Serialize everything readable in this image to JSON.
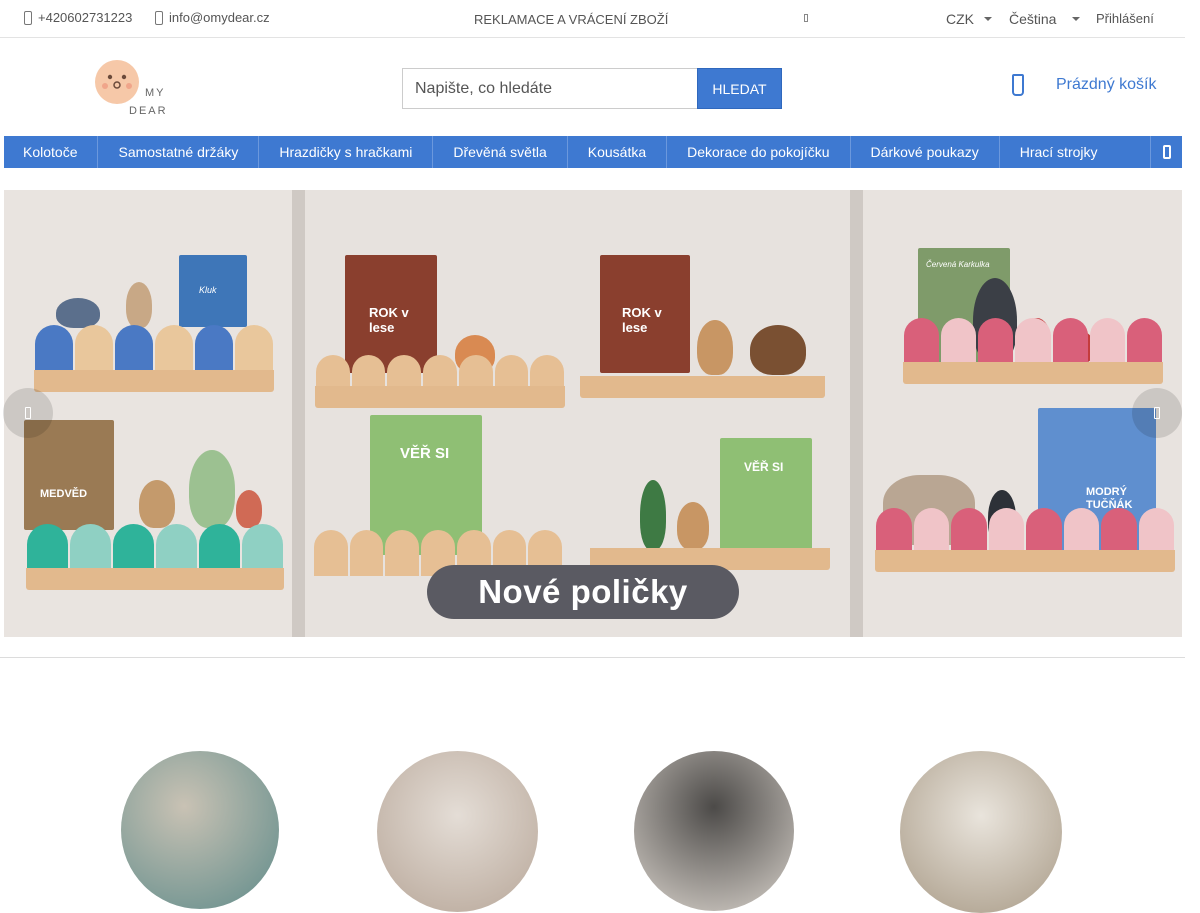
{
  "topbar": {
    "phone": "+420602731223",
    "email": "info@omydear.cz",
    "returns_link": "REKLAMACE A VRÁCENÍ ZBOŽÍ",
    "currency": "CZK",
    "language": "Čeština",
    "login": "Přihlášení"
  },
  "logo": {
    "line1": "MY",
    "line2": "DEAR"
  },
  "search": {
    "placeholder": "Napište, co hledáte",
    "button": "HLEDAT"
  },
  "cart": {
    "label": "Prázdný košík"
  },
  "nav": {
    "items": [
      "Kolotoče",
      "Samostatné držáky",
      "Hrazdičky s hračkami",
      "Dřevěná světla",
      "Kousátka",
      "Dekorace do pokojíčku",
      "Dárkové poukazy",
      "Hrací strojky"
    ]
  },
  "banner": {
    "badge": "Nové poličky",
    "book_titles": [
      "Kluk",
      "MEDVĚD",
      "ROK v lese",
      "ROK v lese",
      "VĚŘ SI",
      "VĚŘ SI",
      "Červená Karkulka",
      "MODRÝ TUČŇÁK"
    ]
  },
  "colors": {
    "accent": "#3e79d1",
    "badge": "#5a5a62"
  }
}
